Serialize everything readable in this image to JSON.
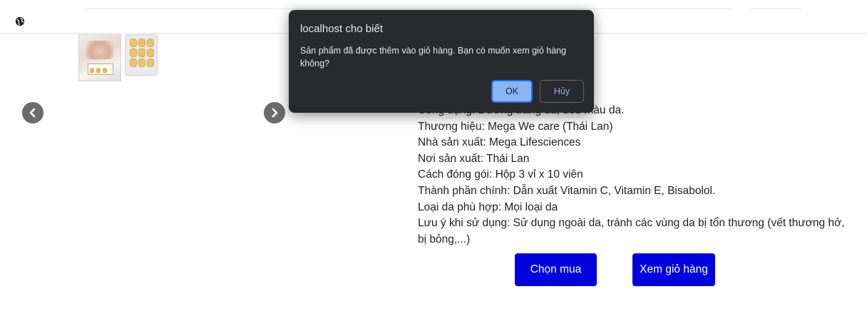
{
  "dialog": {
    "title": "localhost cho biết",
    "message": "Sản phẩm đã được thêm vào giỏ hàng. Bạn có muốn xem giỏ hàng không?",
    "ok_label": "OK",
    "cancel_label": "Hủy"
  },
  "product": {
    "partial_line": "Công dụng: Dưỡng trắng da, đều màu da.",
    "details": [
      "Thương hiệu: Mega We care (Thái Lan)",
      "Nhà sản xuất: Mega Lifesciences",
      "Nơi sản xuất: Thái Lan",
      "Cách đóng gói: Hộp 3 vỉ x 10 viên",
      "Thành phần chính: Dẫn xuất Vitamin C, Vitamin E, Bisabolol.",
      "Loại da phù hợp: Mọi loại da"
    ],
    "note": "Lưu ý khi sử dụng: Sử dụng ngoài da, tránh các vùng da bị tổn thương (vết thương hở, bị bỏng,...)"
  },
  "actions": {
    "buy_label": "Chọn mua",
    "view_cart_label": "Xem giỏ hàng"
  },
  "icons": {
    "globe": "globe-icon",
    "prev": "chevron-left-icon",
    "next": "chevron-right-icon"
  },
  "colors": {
    "primary_button": "#0000dd",
    "dialog_bg": "#292a2d",
    "dialog_ok": "#8ab4f8",
    "arrow_bg": "#6c6c6c"
  }
}
